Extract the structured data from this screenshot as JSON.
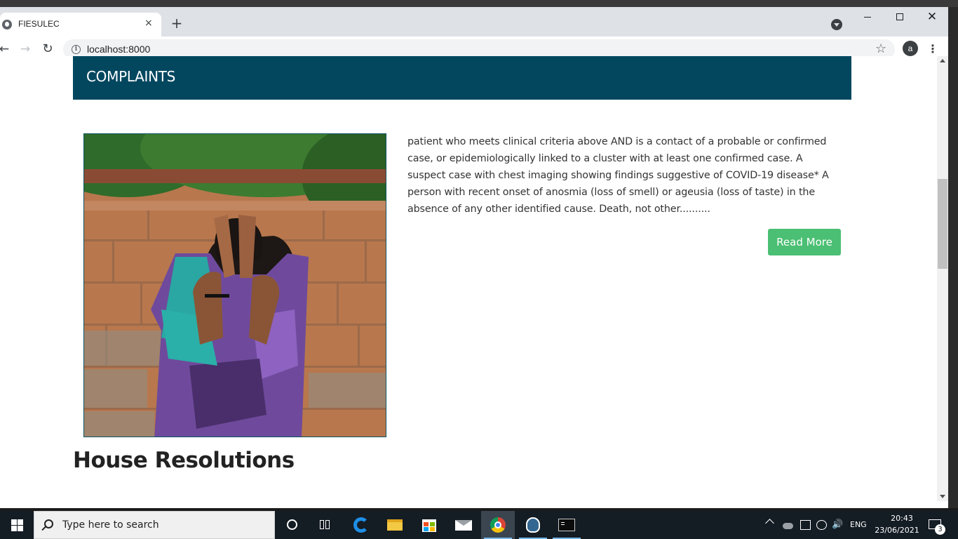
{
  "browser": {
    "tab_title": "FIESULEC",
    "tab_close": "×",
    "new_tab": "+",
    "url": "localhost:8000",
    "profile_initial": "a",
    "menu": "⋮",
    "back": "←",
    "forward": "→",
    "reload": "↻",
    "star": "☆",
    "info": "i",
    "close_window": "✕"
  },
  "page": {
    "banner_title": "COMPLAINTS",
    "article_text": "patient who meets clinical criteria above AND is a contact of a probable or confirmed case, or epidemiologically linked to a cluster with at least one confirmed case. A suspect case with chest imaging showing findings suggestive of COVID-19 disease* A person with recent onset of anosmia (loss of smell) or ageusia (loss of taste) in the absence of any other identified cause. Death, not other..........",
    "read_more_label": "Read More",
    "section_heading": "House Resolutions",
    "banner_color": "#03475f",
    "button_color": "#4bbf73"
  },
  "taskbar": {
    "search_placeholder": "Type here to search",
    "language": "ENG",
    "time": "20:43",
    "date": "23/06/2021",
    "notification_count": "3",
    "volume": "🔊"
  }
}
